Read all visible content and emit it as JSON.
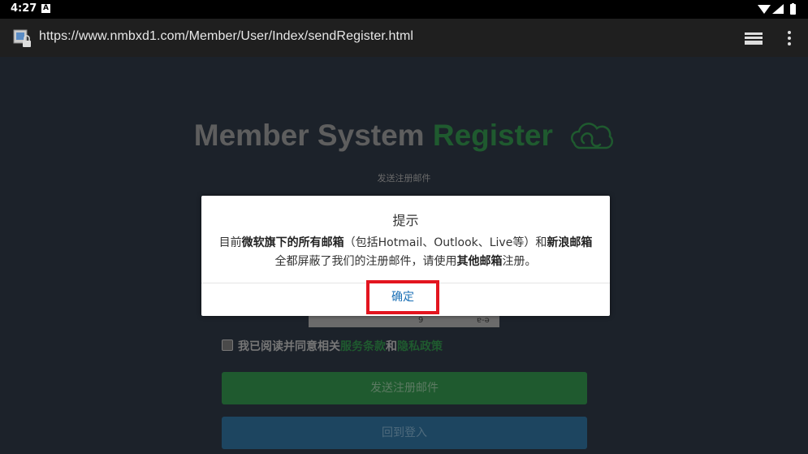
{
  "status_bar": {
    "time": "4:27",
    "notification_letter": "A"
  },
  "browser": {
    "url": "https://www.nmbxd1.com/Member/User/Index/sendRegister.html"
  },
  "page": {
    "title_part1": "Member System",
    "title_part2": "Register",
    "subtitle": "发送注册邮件",
    "captcha_chars": [
      "9",
      "ɐ-ə"
    ],
    "agree_prefix": "我已阅读并同意相关",
    "terms_link": "服务条款",
    "agree_and": "和",
    "privacy_link": "隐私政策",
    "send_button": "发送注册邮件",
    "login_button": "回到登入"
  },
  "dialog": {
    "title": "提示",
    "line1_prefix": "目前",
    "line1_bold1": "微软旗下的所有邮箱",
    "line1_middle": "（包括Hotmail、Outlook、Live等）和",
    "line1_bold2": "新浪邮箱",
    "line2_prefix": "全都屏蔽了我们的注册邮件，请使用",
    "line2_bold": "其他邮箱",
    "line2_suffix": "注册。",
    "ok_button": "确定"
  },
  "colors": {
    "background": "#1c222a",
    "register_green": "#1f5a2f",
    "ok_highlight": "#e3151f",
    "ok_text": "#1a6fb5"
  }
}
